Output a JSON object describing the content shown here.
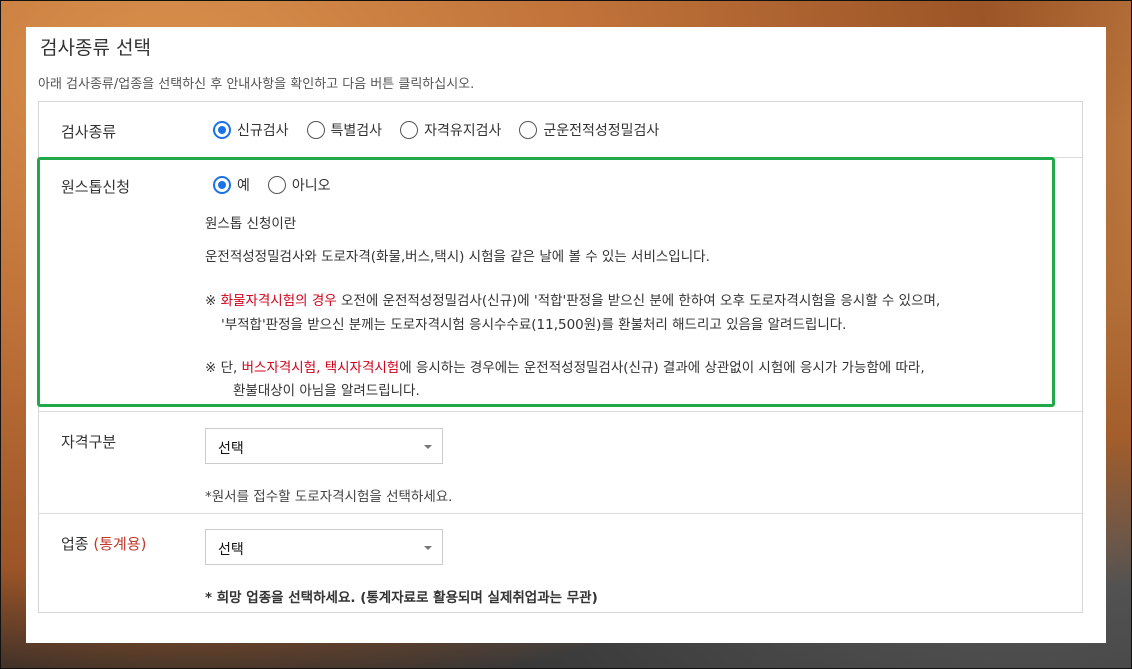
{
  "page": {
    "title": "검사종류 선택",
    "description": "아래 검사종류/업종을 선택하신 후 안내사항을 확인하고 다음 버튼 클릭하십시오."
  },
  "exam_type": {
    "label": "검사종류",
    "options": [
      {
        "label": "신규검사",
        "selected": true
      },
      {
        "label": "특별검사",
        "selected": false
      },
      {
        "label": "자격유지검사",
        "selected": false
      },
      {
        "label": "군운전적성정밀검사",
        "selected": false
      }
    ]
  },
  "onestop": {
    "label": "원스톱신청",
    "options": [
      {
        "label": "예",
        "selected": true
      },
      {
        "label": "아니오",
        "selected": false
      }
    ],
    "info_title": "원스톱 신청이란",
    "info_desc": "운전적성정밀검사와 도로자격(화물,버스,택시) 시험을 같은 날에 볼 수 있는 서비스입니다.",
    "note1_mark": "※ ",
    "note1_red": "화물자격시험의 경우",
    "note1_rest": " 오전에 운전적성정밀검사(신규)에 '적합'판정을 받으신 분에 한하여 오후 도로자격시험을 응시할 수 있으며,",
    "note1_line2": "'부적합'판정을 받으신 분께는 도로자격시험 응시수수료(11,500원)를 환불처리 해드리고 있음을 알려드립니다.",
    "note2_mark": "※ 단, ",
    "note2_red": "버스자격시험, 택시자격시험",
    "note2_rest": "에 응시하는 경우에는 운전적성정밀검사(신규) 결과에 상관없이 시험에 응시가 가능함에 따라,",
    "note2_line2": "환불대상이 아님을 알려드립니다."
  },
  "qualification": {
    "label": "자격구분",
    "select_value": "선택",
    "help": "*원서를 접수할 도로자격시험을 선택하세요."
  },
  "industry": {
    "label": "업종",
    "label_suffix": "(통계용)",
    "select_value": "선택",
    "help": "* 희망 업종을 선택하세요. (통계자료로 활용되며 실제취업과는 무관)"
  },
  "colors": {
    "highlight_border": "#20a84a",
    "radio_selected": "#1a73e8",
    "accent_red": "#d0021b"
  }
}
